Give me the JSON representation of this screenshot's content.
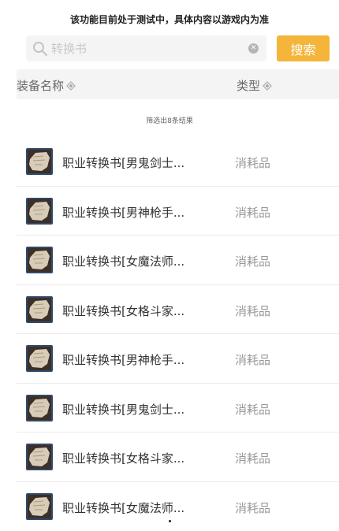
{
  "notice": "该功能目前处于测试中，具体内容以游戏内为准",
  "search": {
    "placeholder": "转换书",
    "button_label": "搜索"
  },
  "table": {
    "col_name": "装备名称",
    "col_type": "类型",
    "result_count": "筛选出8条结果",
    "rows": [
      {
        "name": "职业转换书[男鬼剑士...",
        "type": "消耗品"
      },
      {
        "name": "职业转换书[男神枪手...",
        "type": "消耗品"
      },
      {
        "name": "职业转换书[女魔法师...",
        "type": "消耗品"
      },
      {
        "name": "职业转换书[女格斗家...",
        "type": "消耗品"
      },
      {
        "name": "职业转换书[男神枪手...",
        "type": "消耗品"
      },
      {
        "name": "职业转换书[男鬼剑士...",
        "type": "消耗品"
      },
      {
        "name": "职业转换书[女格斗家...",
        "type": "消耗品"
      },
      {
        "name": "职业转换书[女魔法师...",
        "type": "消耗品"
      }
    ]
  },
  "colors": {
    "accent": "#f5b53b",
    "header_bg": "#f4f4f4",
    "icon_border": "#2f4a6a"
  },
  "icons": {
    "search": "magnifier-icon",
    "clear": "clear-circle-icon",
    "sort": "sort-diamond-icon",
    "item": "scroll-parchment-icon"
  }
}
